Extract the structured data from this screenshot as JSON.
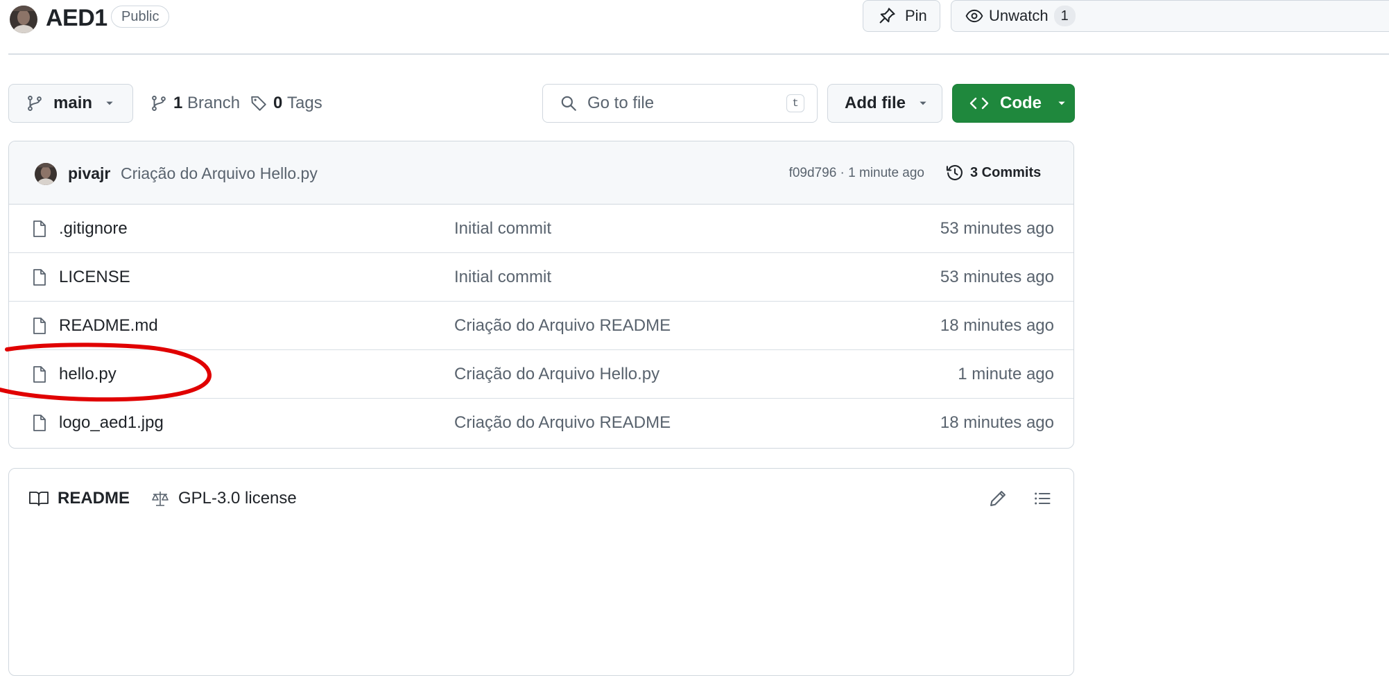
{
  "header": {
    "repo_name": "AED1",
    "visibility_badge": "Public",
    "pin_label": "Pin",
    "watch_label": "Unwatch",
    "watch_count": "1"
  },
  "toolbar": {
    "branch_name": "main",
    "branches_count": "1",
    "branches_label": "Branch",
    "tags_count": "0",
    "tags_label": "Tags",
    "search_placeholder": "Go to file",
    "search_shortcut": "t",
    "add_file_label": "Add file",
    "code_label": "Code"
  },
  "latest_commit": {
    "author": "pivajr",
    "message": "Criação do Arquivo Hello.py",
    "hash_and_time": "f09d796 · 1 minute ago",
    "commits_label": "3 Commits"
  },
  "files": [
    {
      "name": ".gitignore",
      "message": "Initial commit",
      "time": "53 minutes ago"
    },
    {
      "name": "LICENSE",
      "message": "Initial commit",
      "time": "53 minutes ago"
    },
    {
      "name": "README.md",
      "message": "Criação do Arquivo README",
      "time": "18 minutes ago"
    },
    {
      "name": "hello.py",
      "message": "Criação do Arquivo Hello.py",
      "time": "1 minute ago"
    },
    {
      "name": "logo_aed1.jpg",
      "message": "Criação do Arquivo README",
      "time": "18 minutes ago"
    }
  ],
  "readme_tabs": {
    "readme_label": "README",
    "license_label": "GPL-3.0 license"
  },
  "colors": {
    "code_button": "#1f883d",
    "annotation": "#e00000",
    "border": "#d0d7de"
  },
  "icons": [
    "avatar",
    "pin-icon",
    "eye-icon",
    "branch-icon",
    "tag-icon",
    "search-icon",
    "code-icon",
    "history-icon",
    "file-icon",
    "book-icon",
    "scale-icon",
    "pencil-icon",
    "list-icon"
  ]
}
